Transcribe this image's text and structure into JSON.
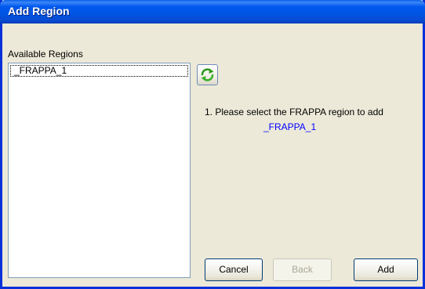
{
  "window": {
    "title": "Add Region"
  },
  "regions_panel": {
    "label": "Available Regions",
    "items": [
      "_FRAPPA_1"
    ]
  },
  "refresh_button": {
    "icon": "refresh-icon"
  },
  "instructions": {
    "step_text": "1. Please select the FRAPPA region to add",
    "selected_region": "_FRAPPA_1"
  },
  "buttons": {
    "cancel_label": "Cancel",
    "back_label": "Back",
    "add_label": "Add"
  },
  "colors": {
    "titlebar": "#0054e3",
    "dialog_bg": "#ece9d8",
    "region_text": "#0000ff",
    "disabled_text": "#a7a697"
  }
}
